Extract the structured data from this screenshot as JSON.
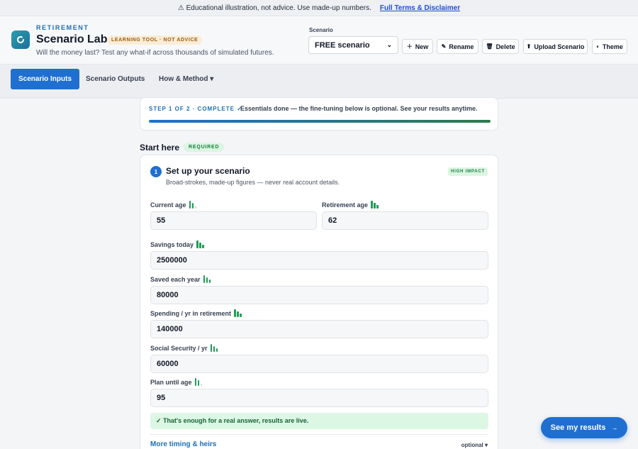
{
  "banner": {
    "text": "⚠ Educational illustration, not advice. Use made-up numbers.",
    "link": "Full Terms & Disclaimer"
  },
  "header": {
    "kicker": "RETIREMENT",
    "title": "Scenario Lab.",
    "badge": "LEARNING TOOL · NOT ADVICE",
    "tagline": "Will the money last? Test any what-if across thousands of simulated futures.",
    "scenario_label": "Scenario",
    "scenario_value": "FREE scenario",
    "buttons": {
      "new": "New",
      "rename": "Rename",
      "delete": "Delete",
      "upload": "Upload Scenario",
      "theme": "Theme"
    }
  },
  "tabs": [
    {
      "label": "Scenario Inputs",
      "active": true
    },
    {
      "label": "Scenario Outputs",
      "active": false
    },
    {
      "label": "How & Method ▾",
      "active": false
    }
  ],
  "progress": {
    "step": "STEP 1 OF 2 · COMPLETE ✓",
    "message": "Essentials done — the fine-tuning below is optional. See your results anytime.",
    "fraction": 1.0
  },
  "start": {
    "title": "Start here",
    "badge": "REQUIRED"
  },
  "section": {
    "number": "1",
    "title": "Set up your scenario",
    "subtitle": "Broad-strokes, made-up figures — never real account details.",
    "impact": "HIGH IMPACT",
    "fields": {
      "current_age": {
        "label": "Current age",
        "value": "55"
      },
      "retirement_age": {
        "label": "Retirement age",
        "value": "62"
      },
      "savings_today": {
        "label": "Savings today",
        "value": "2500000"
      },
      "saved_each_year": {
        "label": "Saved each year",
        "value": "80000"
      },
      "spending": {
        "label": "Spending / yr in retirement",
        "value": "140000"
      },
      "social_security": {
        "label": "Social Security / yr",
        "value": "60000"
      },
      "plan_until": {
        "label": "Plan until age",
        "value": "95"
      }
    },
    "ok_message": "✓ That's enough for a real answer, results are live.",
    "more_link": "More timing & heirs",
    "optional_label": "optional ▾"
  },
  "results_button": {
    "label": "See my results",
    "arrow": "→"
  }
}
